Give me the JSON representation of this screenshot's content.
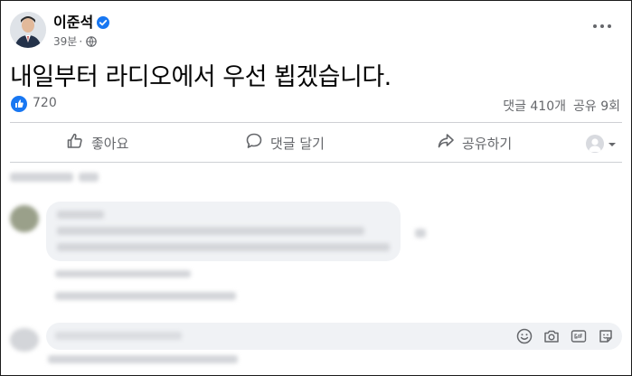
{
  "post": {
    "author": "이준석",
    "time": "39분",
    "separator": "·",
    "text": "내일부터 라디오에서 우선 뵙겠습니다."
  },
  "stats": {
    "reactions": "720",
    "comments": "댓글 410개",
    "shares": "공유 9회"
  },
  "actions": {
    "like": "좋아요",
    "comment": "댓글 달기",
    "share": "공유하기"
  },
  "colors": {
    "accent": "#1877f2",
    "secondary_text": "#65676b",
    "comment_bg": "#f0f2f5"
  },
  "icons": [
    "verified-badge-icon",
    "globe-icon",
    "more-options-icon",
    "like-reaction-icon",
    "thumbs-up-icon",
    "comment-icon",
    "share-icon",
    "chevron-down-icon",
    "emoji-icon",
    "camera-icon",
    "gif-icon",
    "sticker-icon"
  ]
}
